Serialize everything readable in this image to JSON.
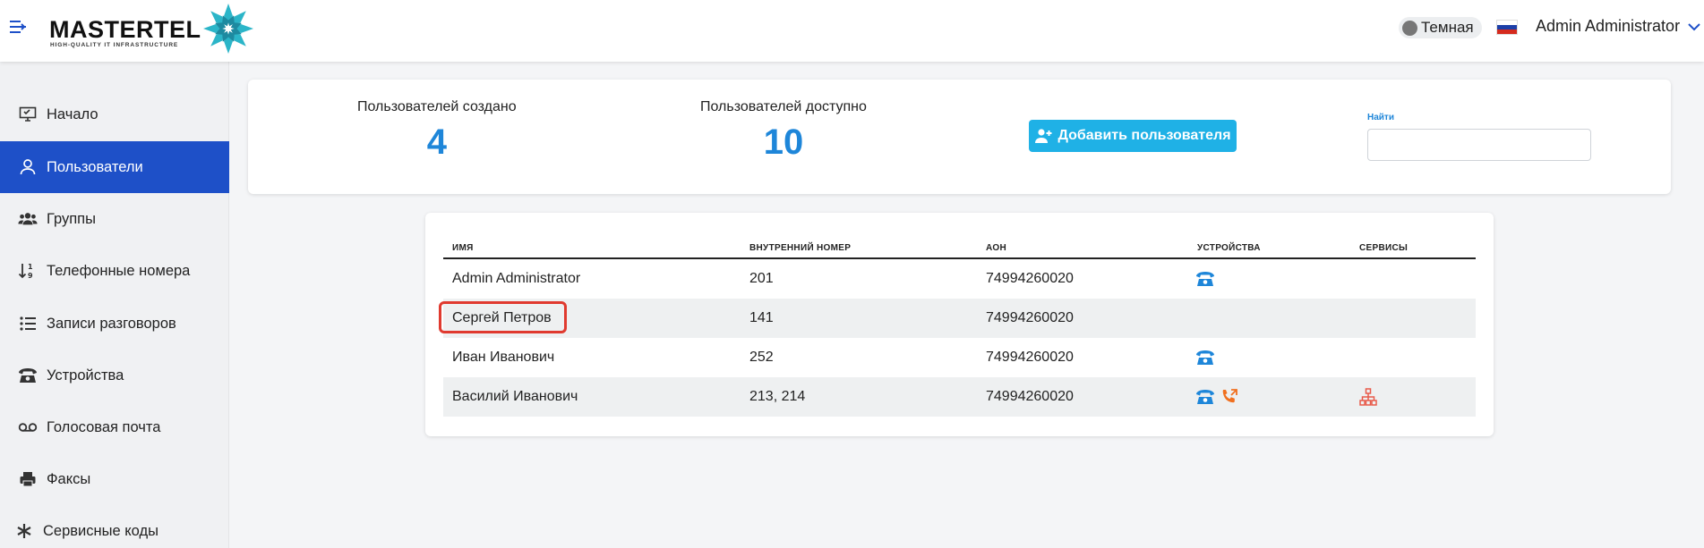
{
  "header": {
    "logo_text": "MASTERTEL",
    "logo_tagline": "HIGH-QUALITY IT INFRASTRUCTURE",
    "theme_label": "Темная",
    "user_name": "Admin Administrator"
  },
  "sidebar": {
    "items": [
      {
        "label": "Начало",
        "icon": "monitor-icon"
      },
      {
        "label": "Пользователи",
        "icon": "user-icon",
        "active": true
      },
      {
        "label": "Группы",
        "icon": "users-group-icon"
      },
      {
        "label": "Телефонные номера",
        "icon": "sort-numbers-icon"
      },
      {
        "label": "Записи разговоров",
        "icon": "list-icon"
      },
      {
        "label": "Устройства",
        "icon": "phone-icon"
      },
      {
        "label": "Голосовая почта",
        "icon": "voicemail-icon"
      },
      {
        "label": "Факсы",
        "icon": "printer-icon"
      },
      {
        "label": "Сервисные коды",
        "icon": "asterisk-icon"
      }
    ]
  },
  "stats": {
    "created_label": "Пользователей создано",
    "created_value": "4",
    "available_label": "Пользователей доступно",
    "available_value": "10",
    "add_button_label": "Добавить пользователя",
    "search_label": "Найти",
    "search_value": ""
  },
  "table": {
    "headers": {
      "name": "ИМЯ",
      "extension": "ВНУТРЕННИЙ НОМЕР",
      "caller_id": "АОН",
      "devices": "УСТРОЙСТВА",
      "services": "СЕРВИСЫ"
    },
    "rows": [
      {
        "name": "Admin Administrator",
        "extension": "201",
        "caller_id": "74994260020",
        "devices": [
          "desk-phone-icon"
        ],
        "services": []
      },
      {
        "name": "Сергей Петров",
        "extension": "141",
        "caller_id": "74994260020",
        "devices": [],
        "services": [],
        "highlighted": true
      },
      {
        "name": "Иван Иванович",
        "extension": "252",
        "caller_id": "74994260020",
        "devices": [
          "desk-phone-icon"
        ],
        "services": []
      },
      {
        "name": "Василий Иванович",
        "extension": "213, 214",
        "caller_id": "74994260020",
        "devices": [
          "desk-phone-icon",
          "call-forward-icon"
        ],
        "services": [
          "hierarchy-icon"
        ]
      }
    ]
  },
  "colors": {
    "accent": "#1e50c8",
    "stat_value": "#1e86d9",
    "add_button": "#1fb1e6",
    "forward_icon": "#f07020",
    "service_icon": "#e85a4a",
    "highlight_border": "#e03a2f"
  }
}
